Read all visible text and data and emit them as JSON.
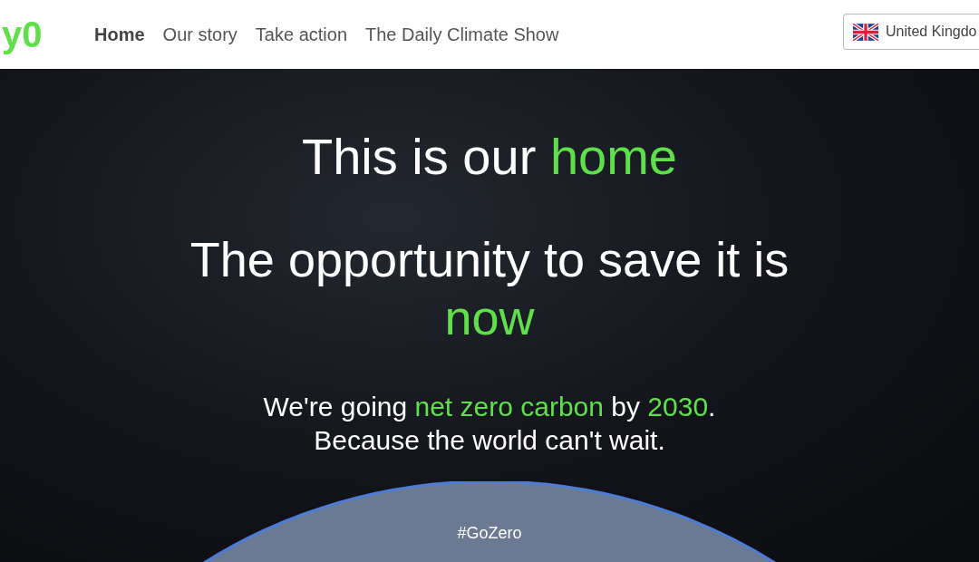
{
  "logo": {
    "text": "y0"
  },
  "nav": [
    {
      "label": "Home",
      "selected": true
    },
    {
      "label": "Our story",
      "selected": false
    },
    {
      "label": "Take action",
      "selected": false
    },
    {
      "label": "The Daily Climate Show",
      "selected": false
    }
  ],
  "country_selector": {
    "label": "United Kingdo"
  },
  "hero": {
    "headline": [
      {
        "text": "This is our ",
        "highlight": false
      },
      {
        "text": "home",
        "highlight": true
      }
    ],
    "subheadline": [
      {
        "text": "The opportunity to save it is ",
        "highlight": false
      },
      {
        "text": "now",
        "highlight": true
      }
    ],
    "body_lines": [
      [
        {
          "text": "We're going ",
          "highlight": false
        },
        {
          "text": "net zero carbon",
          "highlight": true
        },
        {
          "text": " by ",
          "highlight": false
        },
        {
          "text": "2030",
          "highlight": true
        },
        {
          "text": ".",
          "highlight": false
        }
      ],
      [
        {
          "text": "Because the world can't wait.",
          "highlight": false
        }
      ]
    ],
    "hashtag": "#GoZero"
  }
}
